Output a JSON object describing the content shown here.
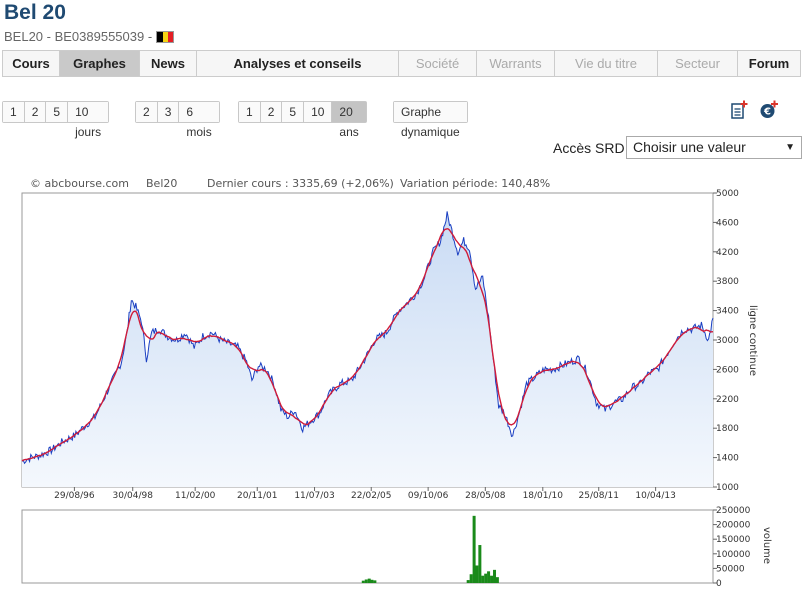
{
  "header": {
    "title": "Bel 20",
    "subtitle": "BEL20 - BE0389555039 -",
    "flag_colors": [
      "#000000",
      "#f4d313",
      "#e41e25"
    ]
  },
  "nav": {
    "tabs": [
      {
        "label": "Cours",
        "state": "normal"
      },
      {
        "label": "Graphes",
        "state": "active"
      },
      {
        "label": "News",
        "state": "normal"
      },
      {
        "label": "Analyses et conseils",
        "state": "normal"
      },
      {
        "label": "Société",
        "state": "disabled"
      },
      {
        "label": "Warrants",
        "state": "disabled"
      },
      {
        "label": "Vie du titre",
        "state": "disabled"
      },
      {
        "label": "Secteur",
        "state": "disabled"
      },
      {
        "label": "Forum",
        "state": "normal"
      }
    ]
  },
  "periods": {
    "days": [
      "1",
      "2",
      "5",
      "10 jours"
    ],
    "months": [
      "2",
      "3",
      "6 mois"
    ],
    "years": [
      "1",
      "2",
      "5",
      "10",
      "20 ans"
    ],
    "active_year": "20 ans",
    "dynamic": "Graphe dynamique"
  },
  "icons": {
    "export": "add-document-icon",
    "currency": "euro-add-icon",
    "accent": "#d9342b",
    "blue": "#1f4a72"
  },
  "srd": {
    "label": "Accès SRD",
    "select_value": "Choisir une valeur"
  },
  "chart_head": {
    "source": "© abcbourse.com",
    "name": "Bel20",
    "last": "Dernier cours : 3335,69 (+2,06%)",
    "variation": "Variation période: 140,48%"
  },
  "chart_data": [
    {
      "type": "line",
      "ylabel": "ligne continue",
      "ylim": [
        1000,
        5000
      ],
      "yticks": [
        "5000",
        "4600",
        "4200",
        "3800",
        "3400",
        "3000",
        "2600",
        "2200",
        "1800",
        "1400",
        "1000"
      ],
      "xtick_labels": [
        "29/08/96",
        "30/04/98",
        "11/02/00",
        "20/11/01",
        "11/07/03",
        "22/02/05",
        "09/10/06",
        "28/05/08",
        "18/01/10",
        "25/08/11",
        "10/04/13"
      ],
      "xlim": [
        "1995-03-01",
        "2014-11-30"
      ],
      "xtick_dates": [
        "1996-08-29",
        "1998-04-30",
        "2000-02-11",
        "2001-11-20",
        "2003-07-11",
        "2005-02-22",
        "2006-10-09",
        "2008-05-28",
        "2010-01-18",
        "2011-08-25",
        "2013-04-10"
      ],
      "colors": {
        "price": "#1a3fc2",
        "average": "#d01c3a",
        "area": "#d7e5f7"
      },
      "series": [
        {
          "x": [
            "1995-03-01",
            "1995-06-01",
            "1995-09-01",
            "1996-01-01",
            "1996-05-01",
            "1996-09-01",
            "1997-01-01",
            "1997-04-01",
            "1997-07-01",
            "1997-10-01",
            "1998-01-01",
            "1998-03-01",
            "1998-04-15",
            "1998-06-01",
            "1998-08-01",
            "1998-09-20",
            "1998-11-15",
            "1999-02-01",
            "1999-05-01",
            "1999-08-01",
            "1999-11-01",
            "2000-02-01",
            "2000-05-01",
            "2000-08-01",
            "2000-11-01",
            "2001-02-01",
            "2001-05-01",
            "2001-08-01",
            "2001-09-25",
            "2001-12-01",
            "2002-03-01",
            "2002-05-15",
            "2002-07-25",
            "2002-10-10",
            "2002-12-15",
            "2003-03-10",
            "2003-06-01",
            "2003-09-01",
            "2003-12-01",
            "2004-04-01",
            "2004-08-01",
            "2004-12-01",
            "2005-04-01",
            "2005-08-01",
            "2005-12-01",
            "2006-03-01",
            "2006-06-15",
            "2006-09-01",
            "2006-12-01",
            "2007-02-15",
            "2007-04-25",
            "2007-06-01",
            "2007-08-15",
            "2007-10-15",
            "2007-12-15",
            "2008-02-15",
            "2008-05-01",
            "2008-07-01",
            "2008-09-01",
            "2008-10-15",
            "2008-12-15",
            "2009-03-10",
            "2009-05-15",
            "2009-08-01",
            "2009-11-01",
            "2010-02-01",
            "2010-05-01",
            "2010-08-01",
            "2010-11-01",
            "2011-02-01",
            "2011-05-01",
            "2011-08-01",
            "2011-11-01",
            "2012-02-01",
            "2012-05-01",
            "2012-08-01",
            "2012-11-01",
            "2013-02-01",
            "2013-05-01",
            "2013-08-01",
            "2013-11-01",
            "2014-02-01",
            "2014-05-01",
            "2014-08-01",
            "2014-10-15",
            "2014-11-30"
          ],
          "values": [
            1350,
            1400,
            1430,
            1500,
            1620,
            1700,
            1850,
            1950,
            2200,
            2450,
            2700,
            3100,
            3550,
            3450,
            3250,
            2750,
            3100,
            3150,
            3050,
            3000,
            3100,
            2900,
            3050,
            3100,
            3000,
            2950,
            2900,
            2700,
            2450,
            2650,
            2600,
            2400,
            2050,
            1950,
            2050,
            1800,
            1900,
            2000,
            2250,
            2400,
            2450,
            2700,
            3000,
            3100,
            3400,
            3500,
            3650,
            3850,
            4200,
            4350,
            4700,
            4550,
            4200,
            4350,
            4250,
            3700,
            3850,
            3300,
            2600,
            2100,
            2000,
            1700,
            2000,
            2400,
            2500,
            2600,
            2600,
            2650,
            2700,
            2750,
            2550,
            2150,
            2050,
            2150,
            2200,
            2350,
            2400,
            2550,
            2600,
            2800,
            3000,
            3150,
            3150,
            3200,
            3000,
            3300
          ]
        }
      ]
    },
    {
      "type": "bar",
      "ylabel": "volume",
      "ylim": [
        0,
        250000
      ],
      "yticks": [
        "250000",
        "200000",
        "150000",
        "100000",
        "50000",
        "0"
      ],
      "color": "#1a8a1a",
      "series": [
        {
          "x": [
            "2004-12-01",
            "2005-01-01",
            "2005-02-01",
            "2005-03-01",
            "2005-04-01",
            "2007-12-01",
            "2008-01-01",
            "2008-02-01",
            "2008-03-01",
            "2008-04-01",
            "2008-05-01",
            "2008-06-01",
            "2008-07-01",
            "2008-08-01",
            "2008-09-01",
            "2008-10-01"
          ],
          "values": [
            8000,
            12000,
            15000,
            11000,
            9000,
            10000,
            30000,
            230000,
            60000,
            130000,
            25000,
            32000,
            40000,
            25000,
            45000,
            20000
          ]
        }
      ]
    }
  ]
}
